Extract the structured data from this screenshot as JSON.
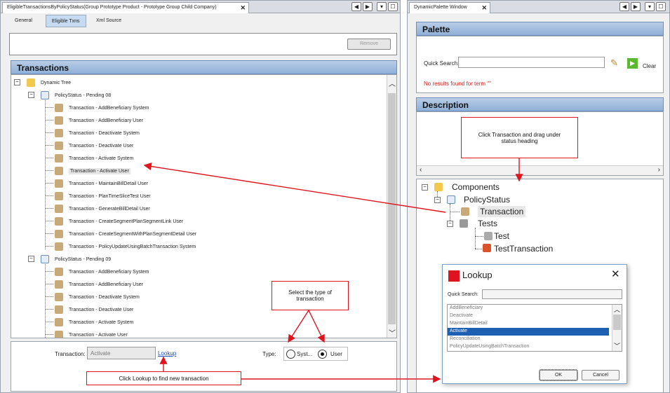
{
  "left": {
    "tab_title": "EligibleTransactionsByPolicyStatus(Group Prototype Product - Prototype Group Child Company)",
    "subtabs": [
      "General",
      "Eligible Txns",
      "Xml Source"
    ],
    "remove_label": "Remove",
    "section_title": "Transactions",
    "tree_root": "Dynamic Tree",
    "groups": [
      {
        "label": "PolicyStatus - Pending 08",
        "items": [
          "Transaction - AddBeneficiary System",
          "Transaction - AddBeneficiary User",
          "Transaction - Deactivate System",
          "Transaction - Deactivate User",
          "Transaction - Activate System",
          "Transaction - Activate User",
          "Transaction - MaintainBillDetail User",
          "Transaction - PlanTimeSliceTest User",
          "Transaction - GenerateBillDetail User",
          "Transaction - CreateSegmentPlanSegmentLink User",
          "Transaction - CreateSegmentWithPlanSegmentDetail User",
          "Transaction - PolicyUpdateUsingBatchTransaction System"
        ]
      },
      {
        "label": "PolicyStatus - Pending 09",
        "items": [
          "Transaction - AddBeneficiary System",
          "Transaction - AddBeneficiary User",
          "Transaction - Deactivate System",
          "Transaction - Deactivate User",
          "Transaction - Activate System",
          "Transaction - Activate User"
        ]
      }
    ],
    "transaction_label": "Transaction:",
    "transaction_value": "Activate",
    "lookup_link": "Lookup",
    "type_label": "Type:",
    "type_options": [
      "Syst...",
      "User"
    ]
  },
  "right": {
    "tab_title": "DynamicPalette Window",
    "palette_title": "Palette",
    "quick_search_label": "Quick Search:",
    "clear_label": "Clear",
    "no_results": "No results found for term \"\"",
    "description_title": "Description",
    "tree": {
      "root": "Components",
      "status": "PolicyStatus",
      "transaction": "Transaction",
      "tests": "Tests",
      "test": "Test",
      "test_transaction": "TestTransaction"
    }
  },
  "lookup": {
    "title": "Lookup",
    "quick_search_label": "Quick Search:",
    "options": [
      "AddBeneficiary",
      "Deactivate",
      "MaintainBillDetail",
      "Activate",
      "Reconciliation",
      "PolicyUpdateUsingBatchTransaction"
    ],
    "selected": "Activate",
    "ok_label": "OK",
    "cancel_label": "Cancel"
  },
  "callouts": {
    "drag": "Click Transaction and drag under status heading",
    "type": "Select the type of transaction",
    "lookup": "Click Lookup to find new transaction"
  },
  "colors": {
    "accent_red": "#e0141e",
    "header_blue": "#8fb0d8",
    "selected_blue": "#1d5fb3"
  }
}
